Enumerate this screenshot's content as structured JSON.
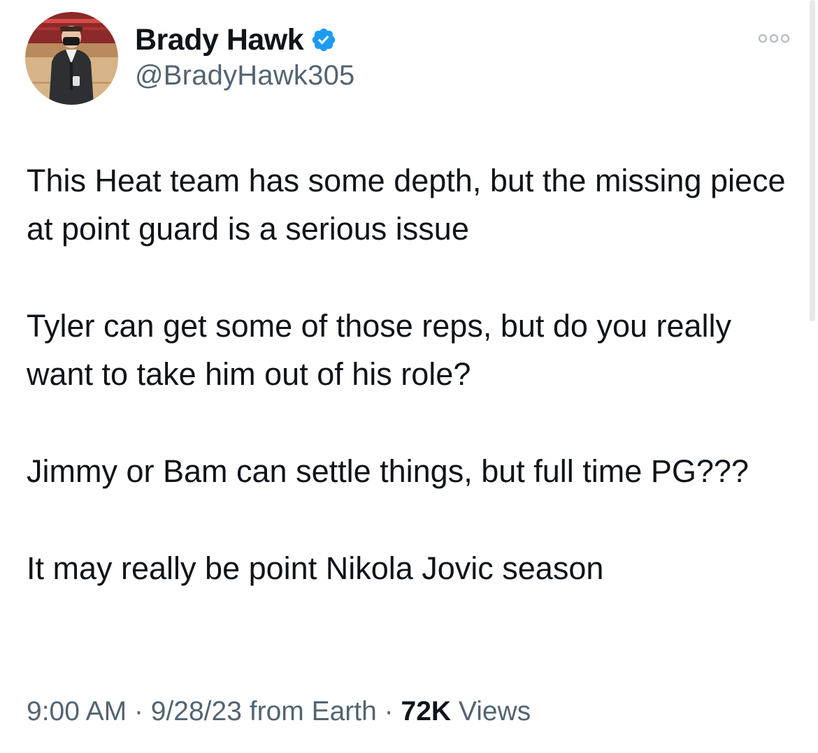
{
  "author": {
    "display_name": "Brady Hawk",
    "handle": "@BradyHawk305",
    "verified": true,
    "avatar_icon": "profile-photo"
  },
  "tweet": {
    "paragraphs": [
      "This Heat team has some depth, but the missing piece at point guard is a serious issue",
      "Tyler can get some of those reps, but do you really want to take him out of his role?",
      "Jimmy or Bam can settle things, but full time PG???",
      "It may really be point Nikola Jovic season"
    ]
  },
  "meta": {
    "time": "9:00 AM",
    "separator": "·",
    "date": "9/28/23",
    "source": "from Earth",
    "views_count": "72K",
    "views_label": "Views"
  },
  "colors": {
    "verified_blue": "#1d9bf0",
    "secondary_text": "#536471",
    "primary_text": "#0f1419",
    "more_dots": "#b8bfc6"
  },
  "icons": {
    "verified": "verified-badge-icon",
    "more": "more-options-icon"
  }
}
